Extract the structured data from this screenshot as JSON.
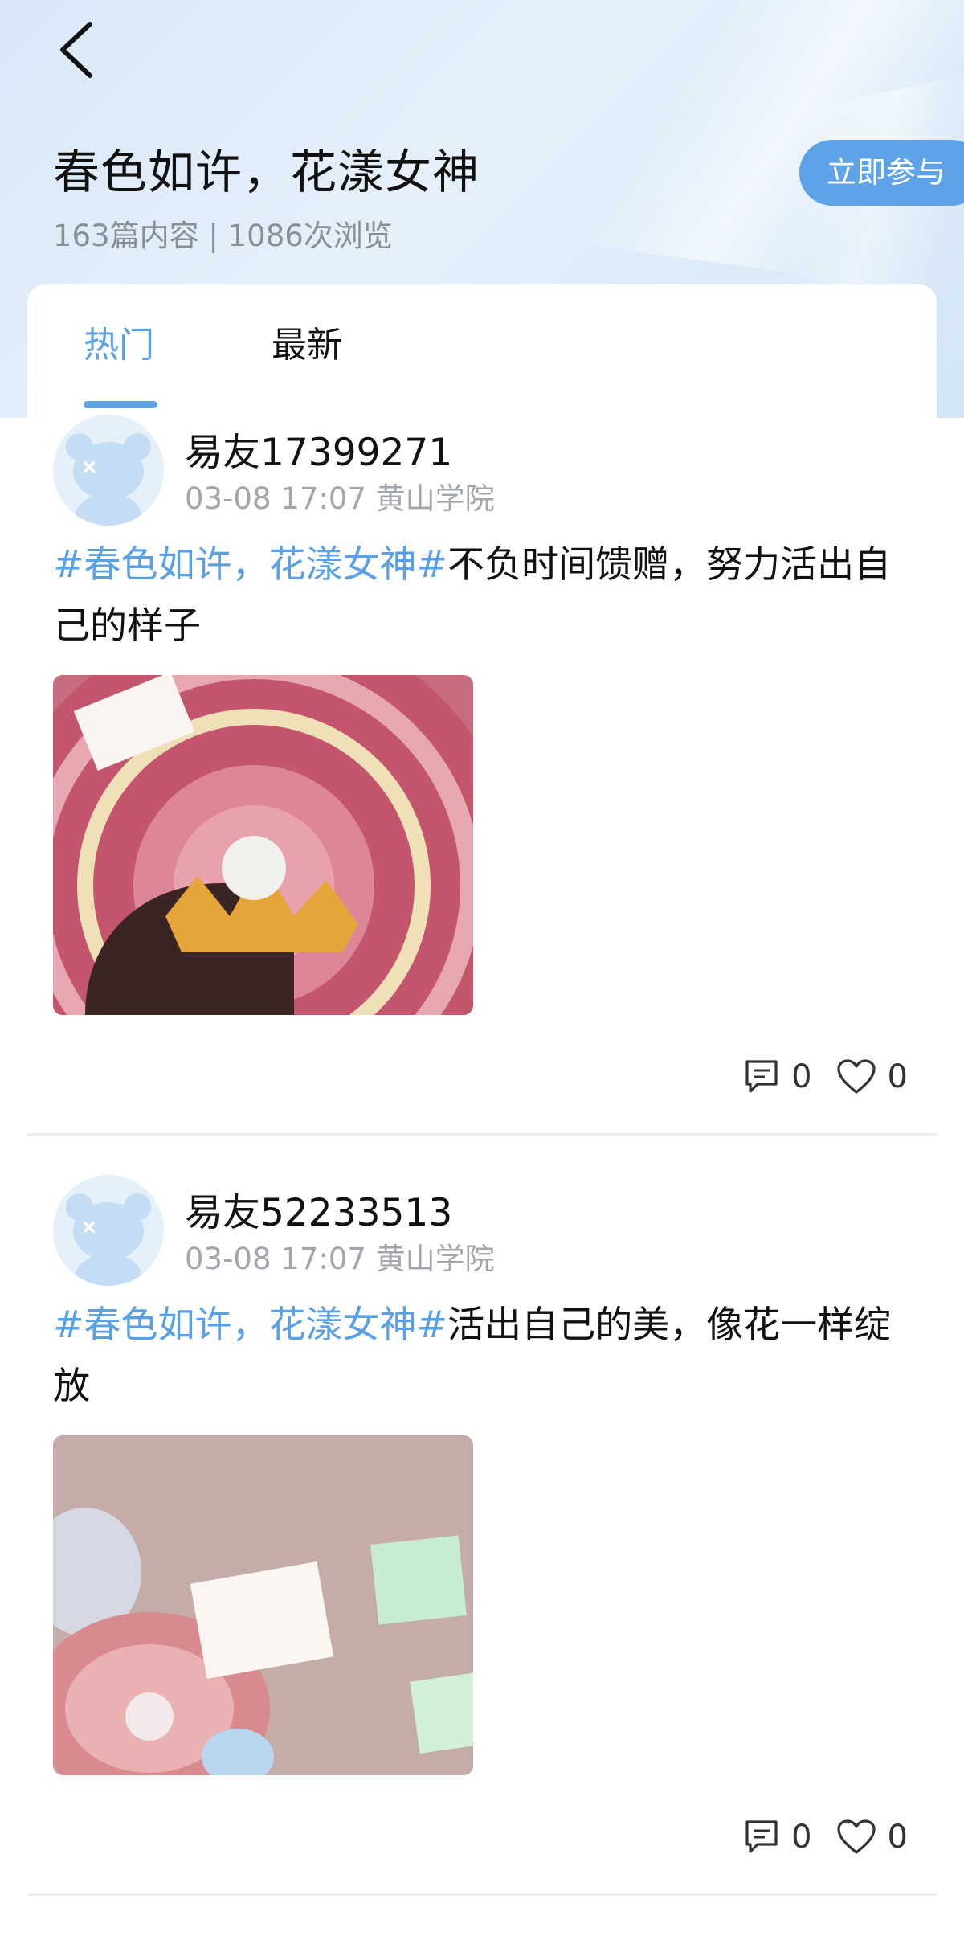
{
  "header": {
    "back_icon": "chevron-left-icon",
    "title": "春色如许，花漾女神",
    "stats": "163篇内容 | 1086次浏览",
    "join_label": "立即参与"
  },
  "tabs": [
    {
      "label": "热门",
      "active": true
    },
    {
      "label": "最新",
      "active": false
    }
  ],
  "colors": {
    "accent": "#5ea3e8",
    "hashtag": "#5aa0e4",
    "hero_bg": "#dce9f7"
  },
  "posts": [
    {
      "author": "易友17399271",
      "meta": "03-08 17:07 黄山学院",
      "hashtag": "#春色如许，花漾女神#",
      "text": "不负时间馈赠，努力活出自己的样子",
      "comment_icon": "comment-icon",
      "comments": "0",
      "like_icon": "heart-icon",
      "likes": "0"
    },
    {
      "author": "易友52233513",
      "meta": "03-08 17:07 黄山学院",
      "hashtag": "#春色如许，花漾女神#",
      "text": "活出自己的美，像花一样绽放",
      "comment_icon": "comment-icon",
      "comments": "0",
      "like_icon": "heart-icon",
      "likes": "0"
    }
  ]
}
